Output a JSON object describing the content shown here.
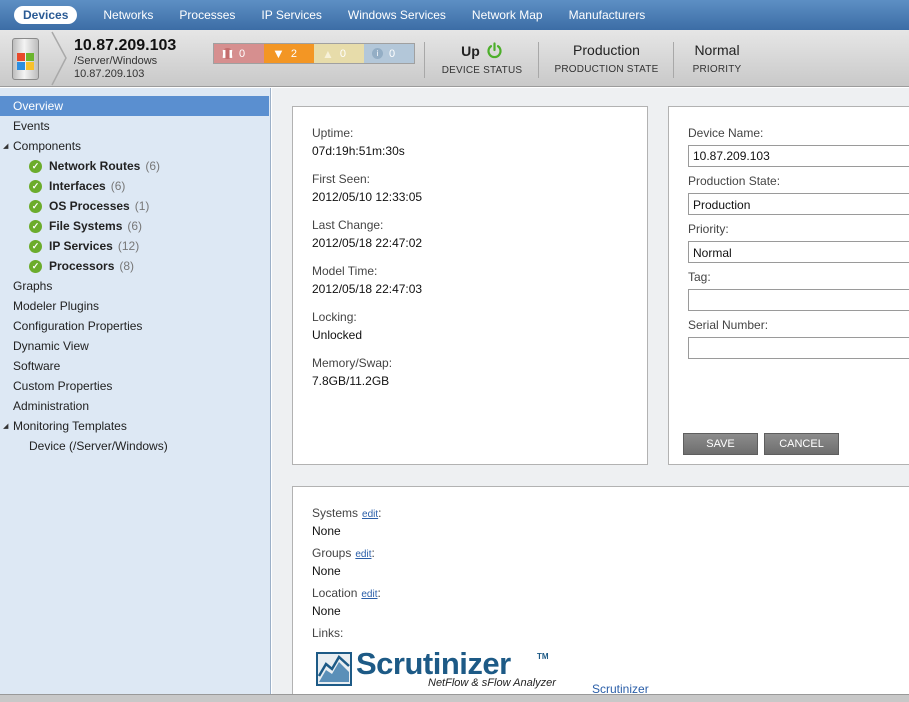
{
  "topnav": {
    "tabs": [
      {
        "label": "Devices",
        "active": true
      },
      {
        "label": "Networks"
      },
      {
        "label": "Processes"
      },
      {
        "label": "IP Services"
      },
      {
        "label": "Windows Services"
      },
      {
        "label": "Network Map"
      },
      {
        "label": "Manufacturers"
      }
    ]
  },
  "device": {
    "ip": "10.87.209.103",
    "class": "/Server/Windows",
    "ip_secondary": "10.87.209.103"
  },
  "events": {
    "critical": "0",
    "error": "2",
    "warning": "0",
    "info": "0"
  },
  "status": {
    "device_status_value": "Up",
    "device_status_label": "DEVICE STATUS",
    "production_value": "Production",
    "production_label": "PRODUCTION STATE",
    "priority_value": "Normal",
    "priority_label": "PRIORITY"
  },
  "sidebar": {
    "items": [
      {
        "label": "Overview",
        "selected": true
      },
      {
        "label": "Events"
      },
      {
        "label": "Components"
      },
      {
        "label": "Graphs"
      },
      {
        "label": "Modeler Plugins"
      },
      {
        "label": "Configuration Properties"
      },
      {
        "label": "Dynamic View"
      },
      {
        "label": "Software"
      },
      {
        "label": "Custom Properties"
      },
      {
        "label": "Administration"
      },
      {
        "label": "Monitoring Templates"
      },
      {
        "label": "Device (/Server/Windows)"
      }
    ],
    "components": [
      {
        "name": "Network Routes",
        "count": "(6)"
      },
      {
        "name": "Interfaces",
        "count": "(6)"
      },
      {
        "name": "OS Processes",
        "count": "(1)"
      },
      {
        "name": "File Systems",
        "count": "(6)"
      },
      {
        "name": "IP Services",
        "count": "(12)"
      },
      {
        "name": "Processors",
        "count": "(8)"
      }
    ]
  },
  "overview": {
    "uptime_label": "Uptime:",
    "uptime": "07d:19h:51m:30s",
    "first_seen_label": "First Seen:",
    "first_seen": "2012/05/10 12:33:05",
    "last_change_label": "Last Change:",
    "last_change": "2012/05/18 22:47:02",
    "model_time_label": "Model Time:",
    "model_time": "2012/05/18 22:47:03",
    "locking_label": "Locking:",
    "locking": "Unlocked",
    "memory_label": "Memory/Swap:",
    "memory": "7.8GB/11.2GB"
  },
  "form": {
    "device_name_label": "Device Name:",
    "device_name": "10.87.209.103",
    "production_state_label": "Production State:",
    "production_state": "Production",
    "priority_label": "Priority:",
    "priority": "Normal",
    "tag_label": "Tag:",
    "tag": "",
    "serial_label": "Serial Number:",
    "serial": "",
    "save": "SAVE",
    "cancel": "CANCEL"
  },
  "org": {
    "systems_label": "Systems",
    "systems": "None",
    "groups_label": "Groups",
    "groups": "None",
    "location_label": "Location",
    "location": "None",
    "edit": "edit",
    "colon": ":",
    "links_label": "Links:"
  },
  "links": {
    "logo_name": "Scrutinizer",
    "logo_tm": "TM",
    "logo_sub": "NetFlow & sFlow Analyzer",
    "scrutinizer_link": "Scrutinizer"
  },
  "colors": {
    "nav_blue": "#3c6da6",
    "selected": "#5a8fd0",
    "sidebar_bg": "#dde8f4",
    "status_up": "#4caf2a",
    "error_orange": "#f39624"
  }
}
